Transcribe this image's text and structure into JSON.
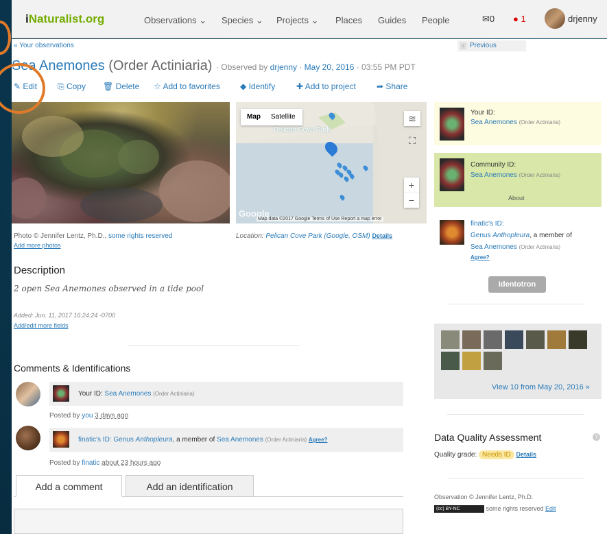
{
  "nav": {
    "logo_i": "i",
    "logo_rest": "Naturalist",
    "logo_org": ".org",
    "links": [
      "Observations ⌄",
      "Species ⌄",
      "Projects ⌄",
      "Places",
      "Guides",
      "People"
    ],
    "messages_count": "0",
    "notifications_count": "1",
    "username": "drjenny"
  },
  "breadcrumb": "« Your observations",
  "previous_label": "Previous",
  "title": {
    "name": "Sea Anemones",
    "order": "(Order Actiniaria)",
    "observed_by_prefix": " · Observed by ",
    "observer": "drjenny",
    "sep": " · ",
    "date": "May 20, 2016",
    "time": " · 03:55 PM PDT"
  },
  "toolbar": {
    "edit": "Edit",
    "copy": "Copy",
    "delete": "Delete",
    "favorites": "Add to favorites",
    "identify": "Identify",
    "add_project": "Add to project",
    "share": "Share"
  },
  "map": {
    "tab_map": "Map",
    "tab_satellite": "Satellite",
    "place_label": "Pelican Cove Park",
    "footer": "Map data ©2017 Google   Terms of Use   Report a map error",
    "google": "Google"
  },
  "photo_caption": {
    "text": "Photo © Jennifer Lentz, Ph.D., ",
    "link": "some rights reserved",
    "add_more": "Add more photos"
  },
  "location": {
    "prefix": "Location: ",
    "place": "Pelican Cove Park (Google, OSM)",
    "details": "Details"
  },
  "description": {
    "heading": "Description",
    "text": "2 open Sea Anemones observed in a tide pool",
    "added": "Added: Jun. 11, 2017 16:24:24 -0700",
    "add_fields": "Add/edit more fields"
  },
  "comments": {
    "heading": "Comments & Identifications",
    "items": [
      {
        "prefix": "Your ID: ",
        "taxon": "Sea Anemones",
        "rank": "(Order Actiniaria)",
        "posted_prefix": "Posted by ",
        "user": "you",
        "when": "3 days ago"
      },
      {
        "prefix": "finatic's ID: ",
        "genus_label": "Genus ",
        "genus": "Anthopleura",
        "member": ", a member of ",
        "taxon": "Sea Anemones",
        "rank": "(Order Actiniaria)",
        "agree": "Agree?",
        "posted_prefix": "Posted by ",
        "user": "finatic",
        "when": "about 23 hours ago"
      }
    ]
  },
  "tabs": {
    "comment": "Add a comment",
    "identification": "Add an identification"
  },
  "sidebar": {
    "your_id_label": "Your ID:",
    "your_id_taxon": "Sea Anemones",
    "your_id_rank": "(Order Actiniaria)",
    "community_label": "Community ID:",
    "community_taxon": "Sea Anemones",
    "community_rank": "(Order Actiniaria)",
    "about": "About",
    "finatic_label": "finatic's ID:",
    "finatic_genus_label": "Genus ",
    "finatic_genus": "Anthopleura",
    "finatic_member": ", a member of",
    "finatic_taxon": "Sea Anemones",
    "finatic_rank": "(Order Actiniaria)",
    "agree": "Agree?",
    "identotron": "Identotron",
    "view_more": "View 10 from May 20, 2016 »",
    "dqa_heading": "Data Quality Assessment",
    "quality_label": "Quality grade: ",
    "quality_value": "Needs ID",
    "quality_details": "Details",
    "copyright": "Observation © Jennifer Lentz, Ph.D.",
    "cc_badge": "(cc) BY-NC",
    "rights": " some rights reserved ",
    "edit": "Edit"
  },
  "colors": {
    "accent": "#2b7bb9",
    "brand": "#74ac00",
    "highlight": "#e07a2a",
    "community_bg": "#d9e8a8",
    "your_id_bg": "#fdfbe0"
  }
}
